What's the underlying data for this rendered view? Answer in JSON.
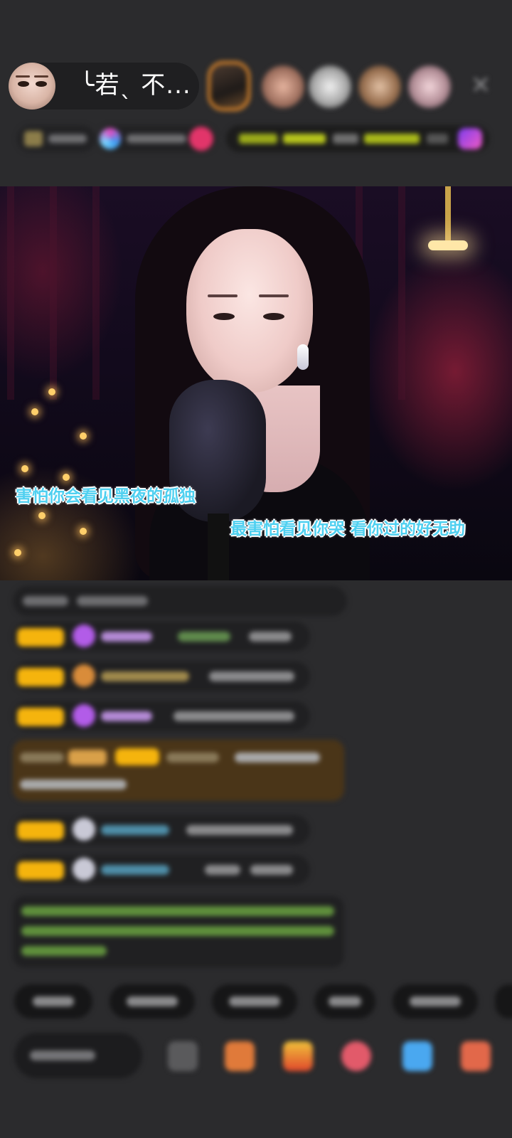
{
  "header": {
    "host_name": "╰若ˎ 不..."
  },
  "video": {
    "lyrics": [
      "害怕你会看见黑夜的孤独",
      "最害怕看见你哭  看你过的好无助"
    ]
  },
  "icons": {
    "close": "close-icon",
    "gift": "gift-icon",
    "mail": "mail-icon",
    "game": "game-icon"
  },
  "colors": {
    "background": "#2b2b2d",
    "lyric_fill": "#4fd0f0",
    "badge": "#f5b40d",
    "accent_pink": "#e2356a"
  }
}
